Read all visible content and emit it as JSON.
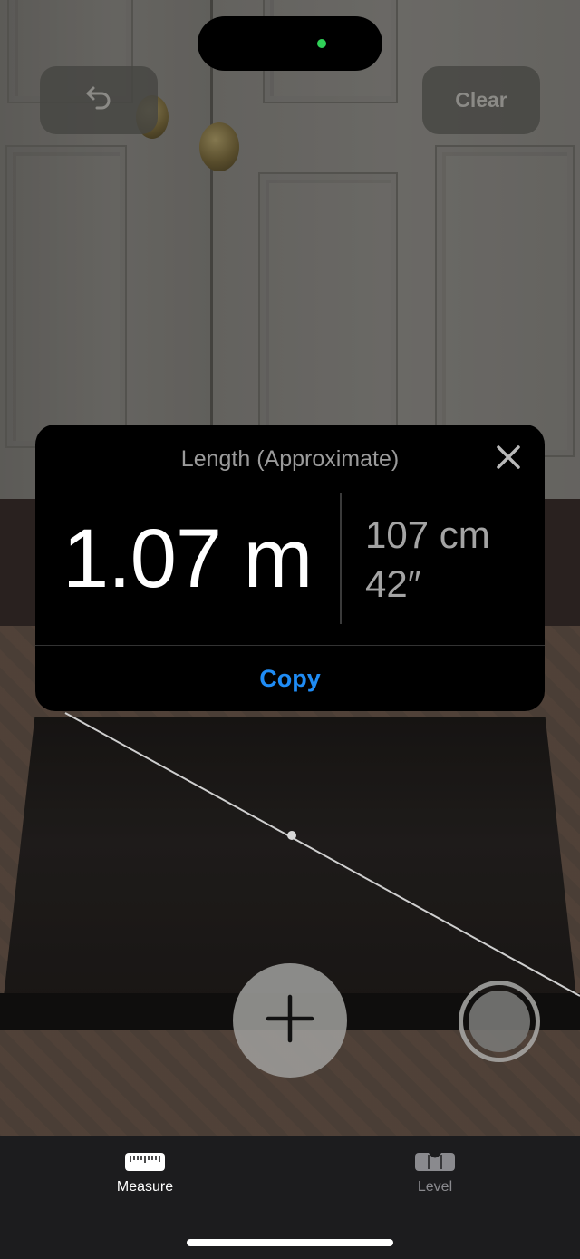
{
  "toolbar": {
    "undo_icon": "undo-arrow-icon",
    "clear_label": "Clear"
  },
  "result_card": {
    "title": "Length (Approximate)",
    "primary_value": "1.07 m",
    "secondary_values": [
      "107 cm",
      "42″"
    ],
    "copy_label": "Copy",
    "close_icon": "close-icon"
  },
  "controls": {
    "add_point_icon": "plus-icon",
    "capture_icon": "shutter-icon"
  },
  "tab_bar": {
    "tabs": [
      {
        "label": "Measure",
        "icon": "ruler-icon",
        "selected": true
      },
      {
        "label": "Level",
        "icon": "level-icon",
        "selected": false
      }
    ]
  },
  "colors": {
    "accent_blue": "#1f8cf5",
    "status_dot_green": "#30d158",
    "card_background": "#000000",
    "tab_bar_background": "#1c1c1e"
  }
}
